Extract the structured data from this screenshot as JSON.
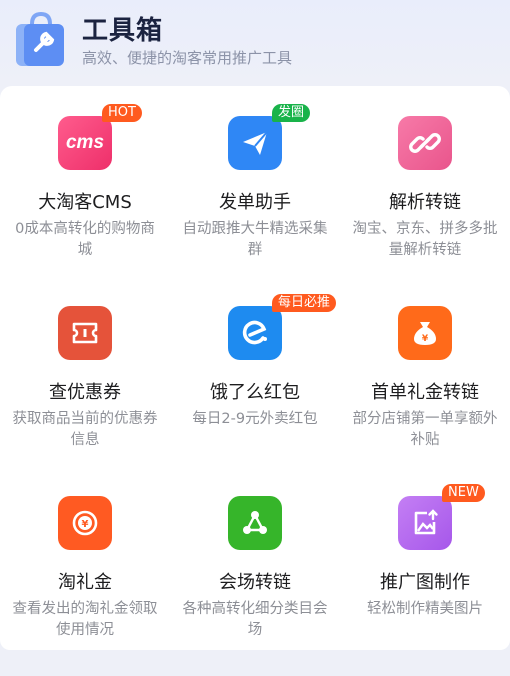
{
  "header": {
    "title": "工具箱",
    "subtitle": "高效、便捷的淘客常用推广工具"
  },
  "tools": [
    {
      "name": "大淘客CMS",
      "desc": "0成本高转化的购物商城",
      "icon": "cms-icon",
      "color": "#f2487b",
      "badge": "HOT",
      "badge_color": "#ff5a1f",
      "icon_text": "cms"
    },
    {
      "name": "发单助手",
      "desc": "自动跟推大牛精选采集群",
      "icon": "paper-plane-icon",
      "color": "#2f87f5",
      "badge": "发圈",
      "badge_color": "#19b34a"
    },
    {
      "name": "解析转链",
      "desc": "淘宝、京东、拼多多批量解析转链",
      "icon": "link-icon",
      "color": "#f06a9c",
      "badge": null
    },
    {
      "name": "查优惠券",
      "desc": "获取商品当前的优惠券信息",
      "icon": "coupon-icon",
      "color": "#e5533a",
      "badge": null
    },
    {
      "name": "饿了么红包",
      "desc": "每日2-9元外卖红包",
      "icon": "eleme-icon",
      "color": "#1e8bf0",
      "badge": "每日必推",
      "badge_color": "#ff5a1f"
    },
    {
      "name": "首单礼金转链",
      "desc": "部分店铺第一单享额外补贴",
      "icon": "money-bag-icon",
      "color": "#ff6a1a",
      "badge": null
    },
    {
      "name": "淘礼金",
      "desc": "查看发出的淘礼金领取使用情况",
      "icon": "yuan-coin-icon",
      "color": "#ff5a22",
      "badge": null
    },
    {
      "name": "会场转链",
      "desc": "各种高转化细分类目会场",
      "icon": "share-nodes-icon",
      "color": "#36b52a",
      "badge": null
    },
    {
      "name": "推广图制作",
      "desc": "轻松制作精美图片",
      "icon": "image-upload-icon",
      "color": "#b566ef",
      "badge": "NEW",
      "badge_color": "#ff5a1f"
    }
  ]
}
